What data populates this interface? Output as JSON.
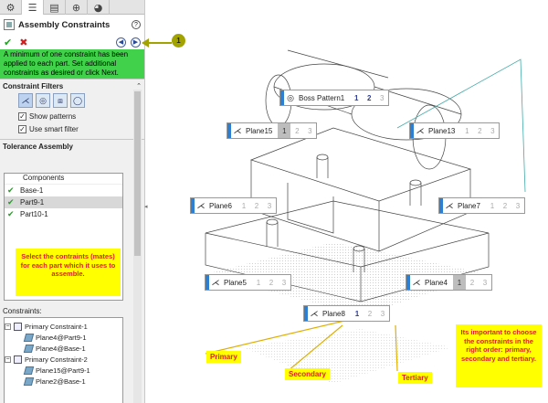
{
  "panel": {
    "tabs": [
      {
        "icon": "feature-manager-icon",
        "glyph": "⚙"
      },
      {
        "icon": "property-manager-icon",
        "glyph": "☰"
      },
      {
        "icon": "configuration-manager-icon",
        "glyph": "▤"
      },
      {
        "icon": "dimxpert-manager-icon",
        "glyph": "⊕"
      },
      {
        "icon": "display-manager-icon",
        "glyph": "◕"
      }
    ],
    "title": "Assembly Constraints",
    "help": "?",
    "ok": "✔",
    "cancel": "✖",
    "back": "◀",
    "next": "▶",
    "message": "A minimum of one constraint has been applied to each part. Set additional constraints as desired or click Next.",
    "filters_title": "Constraint Filters",
    "filter_icons": [
      "angle-icon",
      "coincident-icon",
      "parallel-icon",
      "tangent-icon"
    ],
    "filter_glyphs": [
      "⋌",
      "◎",
      "⧈",
      "◯"
    ],
    "show_patterns": "Show patterns",
    "use_smart_filter": "Use smart filter",
    "tolerance_title": "Tolerance Assembly",
    "components_header": "Components",
    "components": [
      "Base-1",
      "Part9-1",
      "Part10-1"
    ],
    "note": "Select the contraints (mates) for each part which it uses to assemble.",
    "constraints_label": "Constraints:",
    "constraints": [
      {
        "label": "Primary Constraint-1",
        "children": [
          "Plane4@Part9-1",
          "Plane4@Base-1"
        ]
      },
      {
        "label": "Primary Constraint-2",
        "children": [
          "Plane15@Part9-1",
          "Plane2@Base-1"
        ]
      }
    ]
  },
  "callout": "1",
  "viewport": {
    "constraint_boxes": [
      {
        "name": "Boss Pattern1",
        "icon": "◎",
        "nums": [
          "1",
          "2",
          "3"
        ],
        "state": "boss"
      },
      {
        "name": "Plane15",
        "icon": "⋌",
        "nums": [
          "1",
          "2",
          "3"
        ],
        "state": "p1sel"
      },
      {
        "name": "Plane13",
        "icon": "⋌",
        "nums": [
          "1",
          "2",
          "3"
        ],
        "state": "none"
      },
      {
        "name": "Plane6",
        "icon": "⋌",
        "nums": [
          "1",
          "2",
          "3"
        ],
        "state": "none"
      },
      {
        "name": "Plane7",
        "icon": "⋌",
        "nums": [
          "1",
          "2",
          "3"
        ],
        "state": "none"
      },
      {
        "name": "Plane5",
        "icon": "⋌",
        "nums": [
          "1",
          "2",
          "3"
        ],
        "state": "none"
      },
      {
        "name": "Plane4",
        "icon": "⋌",
        "nums": [
          "1",
          "2",
          "3"
        ],
        "state": "p1sel"
      },
      {
        "name": "Plane8",
        "icon": "⋌",
        "nums": [
          "1",
          "2",
          "3"
        ],
        "state": "p1"
      }
    ],
    "labels": {
      "primary": "Primary",
      "secondary": "Secondary",
      "tertiary": "Tertiary"
    },
    "order_note": "Its important to choose the constraints in the right order: primary, secondary and tertiary."
  },
  "colors": {
    "message_bg": "#42d14b",
    "note_bg": "#ffff00",
    "note_text": "#e02020",
    "callout": "#a3a300",
    "accent": "#2f7fd0"
  }
}
